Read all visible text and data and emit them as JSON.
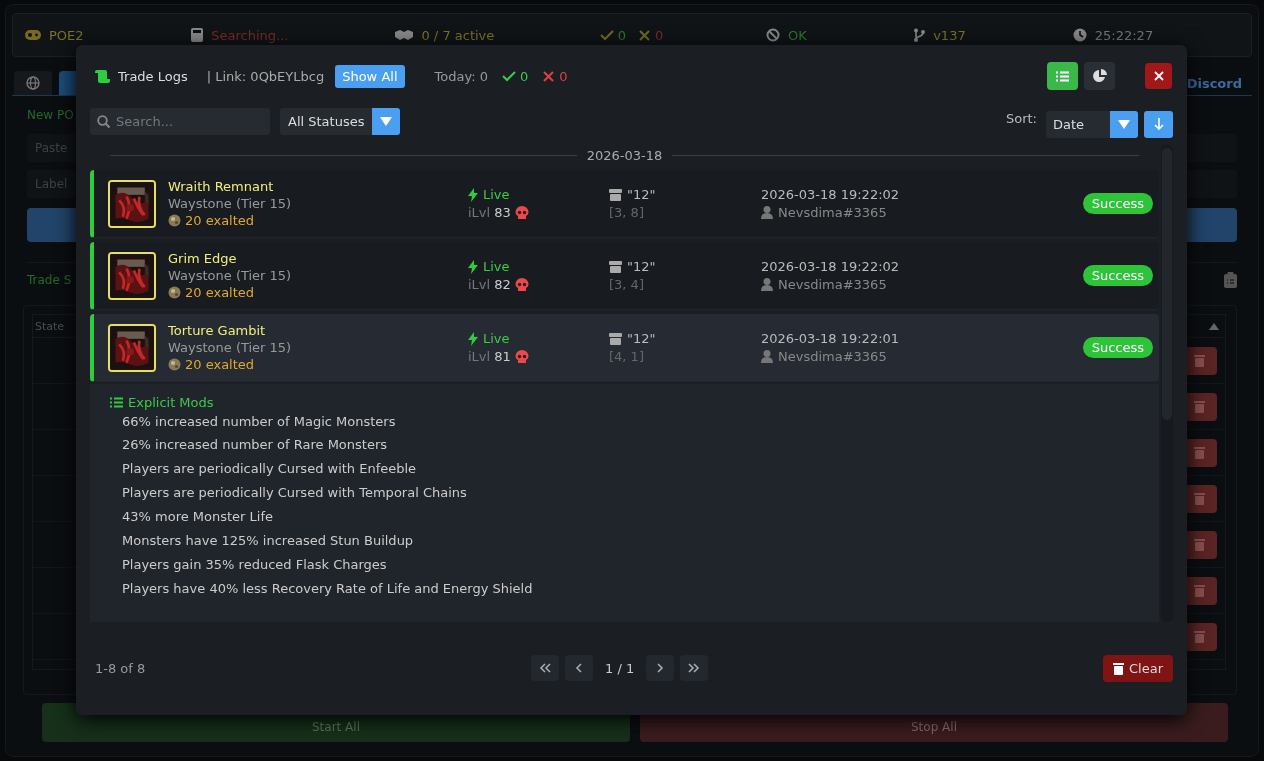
{
  "app": {
    "status_bar": {
      "game": "POE2",
      "search_state": "Searching...",
      "active": "0 / 7 active",
      "success_count": "0",
      "fail_count": "0",
      "connection": "OK",
      "version": "v137",
      "clock": "25:22:27"
    },
    "tabs": [
      {
        "selected": false
      },
      {
        "selected": true
      }
    ],
    "discord_link": "Discord",
    "new_label": "New PO",
    "fields": [
      {
        "placeholder": "Paste"
      },
      {
        "placeholder": "Label"
      }
    ],
    "section_title": "Trade S",
    "table": {
      "columns": [
        "State"
      ]
    },
    "buttons": [
      "Start All",
      "Stop All"
    ]
  },
  "modal": {
    "title": "Trade Logs",
    "link": "| Link: 0QbEYLbcg",
    "show_all": "Show All",
    "today": "Today: 0",
    "success_count": "0",
    "fail_count": "0",
    "view_buttons": [
      {
        "kind": "list",
        "selected": true
      },
      {
        "kind": "chart",
        "selected": false
      }
    ],
    "search": {
      "placeholder": "Search..."
    },
    "status_filter": "All Statuses",
    "sort_label": "Sort:",
    "sort_value": "Date",
    "date_group": "2026-03-18",
    "entries": [
      {
        "name": "Wraith Remnant",
        "base": "Waystone (Tier 15)",
        "price": "20 exalted",
        "mode": "Live",
        "ilvl_label": "iLvl",
        "ilvl": "83",
        "corrupted": true,
        "stash": "\"12\"",
        "position": "[3, 8]",
        "time": "2026-03-18 19:22:02",
        "player": "Nevsdima#3365",
        "status": "Success",
        "expanded": false
      },
      {
        "name": "Grim Edge",
        "base": "Waystone (Tier 15)",
        "price": "20 exalted",
        "mode": "Live",
        "ilvl_label": "iLvl",
        "ilvl": "82",
        "corrupted": true,
        "stash": "\"12\"",
        "position": "[3, 4]",
        "time": "2026-03-18 19:22:02",
        "player": "Nevsdima#3365",
        "status": "Success",
        "expanded": false
      },
      {
        "name": "Torture Gambit",
        "base": "Waystone (Tier 15)",
        "price": "20 exalted",
        "mode": "Live",
        "ilvl_label": "iLvl",
        "ilvl": "81",
        "corrupted": true,
        "stash": "\"12\"",
        "position": "[4, 1]",
        "time": "2026-03-18 19:22:01",
        "player": "Nevsdima#3365",
        "status": "Success",
        "expanded": true,
        "mods_title": "Explicit Mods",
        "mods": [
          "66% increased number of Magic Monsters",
          "26% increased number of Rare Monsters",
          "Players are periodically Cursed with Enfeeble",
          "Players are periodically Cursed with Temporal Chains",
          "43% more Monster Life",
          "Monsters have 125% increased Stun Buildup",
          "Players gain 35% reduced Flask Charges",
          "Players have 40% less Recovery Rate of Life and Energy Shield"
        ]
      }
    ],
    "footer": {
      "range": "1-8 of 8",
      "page": "1 / 1",
      "clear": "Clear"
    }
  }
}
